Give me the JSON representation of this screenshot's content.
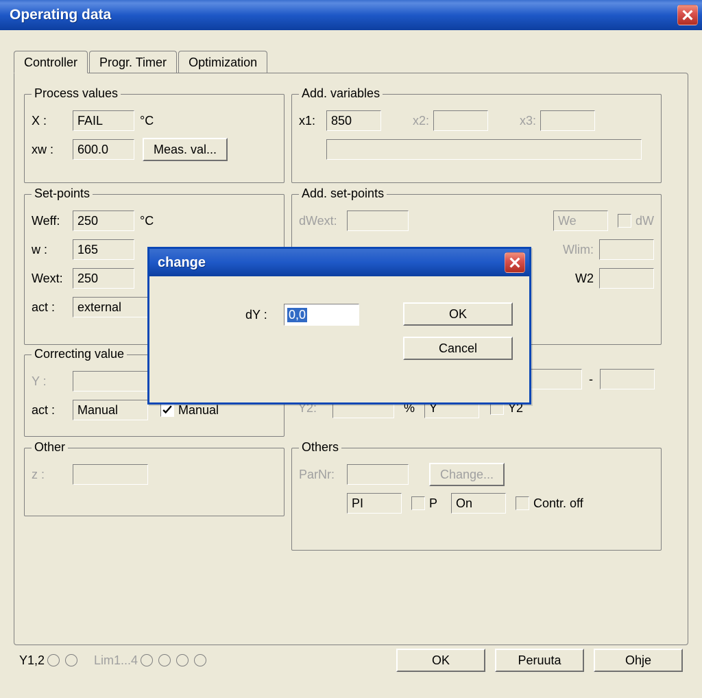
{
  "main": {
    "title": "Operating data"
  },
  "tabs": {
    "controller": "Controller",
    "progr_timer": "Progr. Timer",
    "optimization": "Optimization"
  },
  "process_values": {
    "legend": "Process values",
    "x_label": "X :",
    "x_value": "FAIL",
    "x_unit": "°C",
    "xw_label": "xw :",
    "xw_value": "600.0",
    "meas_button": "Meas. val..."
  },
  "add_variables": {
    "legend": "Add. variables",
    "x1_label": "x1:",
    "x1_value": "850",
    "x2_label": "x2:",
    "x3_label": "x3:"
  },
  "set_points": {
    "legend": "Set-points",
    "weff_label": "Weff:",
    "weff_value": "250",
    "weff_unit": "°C",
    "w_label": "w :",
    "w_value": "165",
    "wext_label": "Wext:",
    "wext_value": "250",
    "act_label": "act :",
    "act_value": "external"
  },
  "add_set_points": {
    "legend": "Add. set-points",
    "dwext_label": "dWext:",
    "we_label": "We",
    "dw_label": "dW",
    "wlim_label": "Wlim:",
    "w2_label": "W2"
  },
  "correcting_value": {
    "legend": "Correcting value",
    "y_label": "Y :",
    "act_label": "act :",
    "act_value": "Manual",
    "manual_label": "Manual"
  },
  "correcting_right": {
    "y2_label": "Y2:",
    "pct": "%",
    "y_value": "Y",
    "y2_chk_label": "Y2"
  },
  "other": {
    "legend": "Other",
    "z_label": "z :"
  },
  "others": {
    "legend": "Others",
    "parnr_label": "ParNr:",
    "change_button": "Change...",
    "pi_value": "PI",
    "p_label": "P",
    "on_value": "On",
    "contr_off_label": "Contr. off"
  },
  "bottom": {
    "y12_label": "Y1,2",
    "lim_label": "Lim1...4",
    "ok": "OK",
    "cancel": "Peruuta",
    "help": "Ohje"
  },
  "modal": {
    "title": "change",
    "field_label": "dY :",
    "field_value": "0,0",
    "ok": "OK",
    "cancel": "Cancel"
  }
}
